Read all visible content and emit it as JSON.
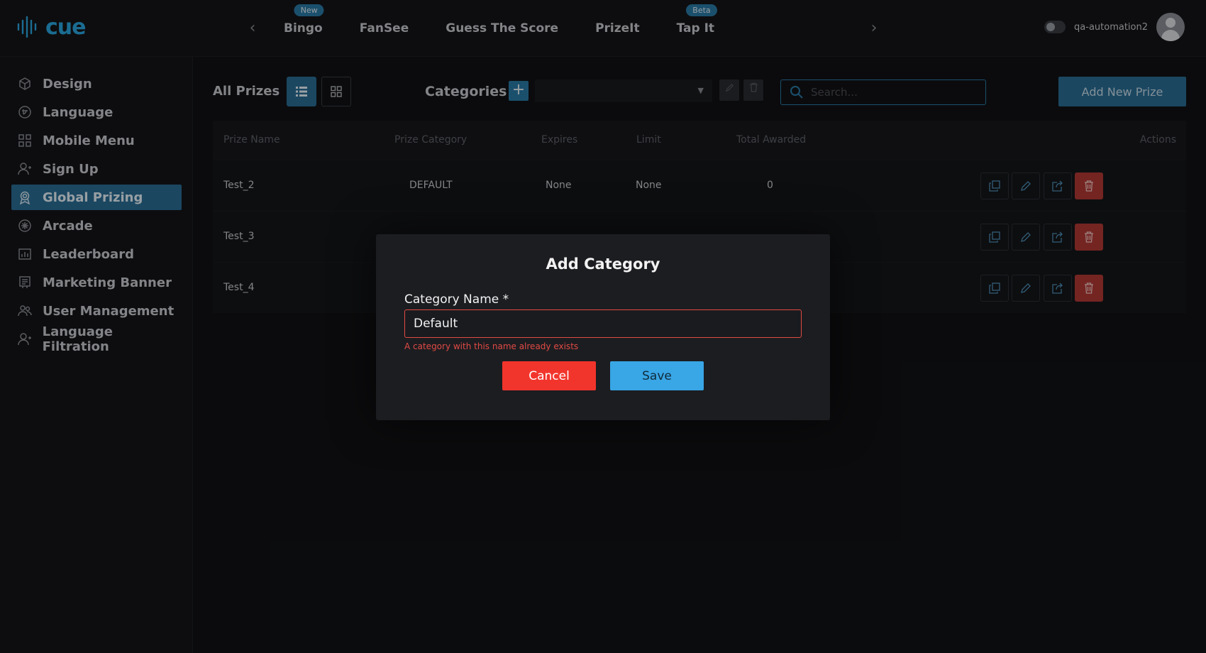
{
  "app": {
    "brand": "cue",
    "accent": "#2aa6e0"
  },
  "topnav": {
    "tabs": [
      {
        "label": "Bingo",
        "badge": "New"
      },
      {
        "label": "FanSee",
        "badge": ""
      },
      {
        "label": "Guess The Score",
        "badge": ""
      },
      {
        "label": "PrizeIt",
        "badge": ""
      },
      {
        "label": "Tap It",
        "badge": "Beta"
      }
    ],
    "username": "qa-automation2"
  },
  "sidebar": {
    "items": [
      {
        "label": "Design",
        "icon": "cube-icon"
      },
      {
        "label": "Language",
        "icon": "language-icon"
      },
      {
        "label": "Mobile Menu",
        "icon": "grid-icon"
      },
      {
        "label": "Sign Up",
        "icon": "user-plus-icon"
      },
      {
        "label": "Global Prizing",
        "icon": "award-icon",
        "active": true
      },
      {
        "label": "Arcade",
        "icon": "arcade-icon"
      },
      {
        "label": "Leaderboard",
        "icon": "leaderboard-icon"
      },
      {
        "label": "Marketing Banner",
        "icon": "banner-icon"
      },
      {
        "label": "User Management",
        "icon": "users-icon"
      },
      {
        "label": "Language Filtration",
        "icon": "user-plus-icon"
      }
    ]
  },
  "toolbar": {
    "title": "All Prizes",
    "categories_label": "Categories",
    "search_placeholder": "Search...",
    "add_new_prize": "Add New Prize"
  },
  "table": {
    "headers": [
      "Prize Name",
      "Prize Category",
      "Expires",
      "Limit",
      "Total Awarded",
      "Actions"
    ],
    "rows": [
      {
        "name": "Test_2",
        "category": "DEFAULT",
        "expires": "None",
        "limit": "None",
        "awarded": "0"
      },
      {
        "name": "Test_3",
        "category": "",
        "expires": "",
        "limit": "",
        "awarded": ""
      },
      {
        "name": "Test_4",
        "category": "",
        "expires": "",
        "limit": "",
        "awarded": ""
      }
    ]
  },
  "modal": {
    "title": "Add Category",
    "field_label": "Category Name *",
    "field_value": "Default",
    "error": "A category with this name already exists",
    "cancel": "Cancel",
    "save": "Save"
  }
}
